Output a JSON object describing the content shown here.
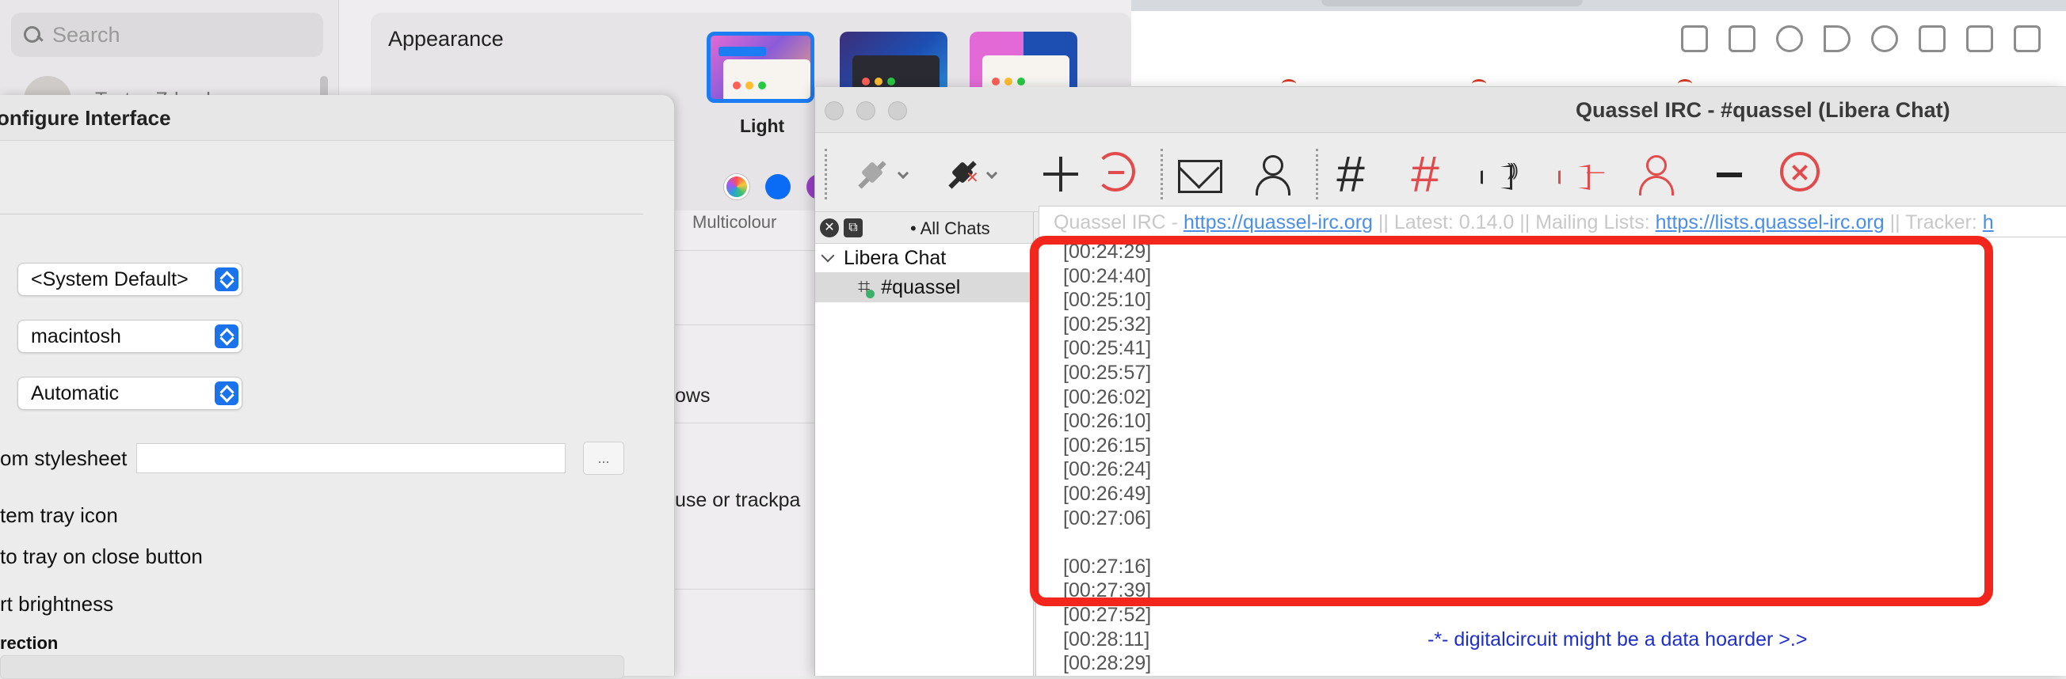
{
  "settings": {
    "search_placeholder": "Search",
    "user_name": "Tsvtsc Zdravkov",
    "appearance_label": "Appearance",
    "theme_light_label": "Light",
    "accent_label": "Multicolour",
    "row_windows": "ows",
    "row_trackpad": "use or trackpa"
  },
  "browser": {
    "toolbar_icons": [
      "edit-icon",
      "camera-icon",
      "shield-icon",
      "send-icon",
      "heart-icon",
      "download-icon",
      "add-icon",
      "sliders-icon"
    ]
  },
  "config": {
    "title": "onfigure Interface",
    "popups": [
      "<System Default>",
      "macintosh",
      "Automatic"
    ],
    "stylesheet_label": "om stylesheet",
    "browse_label": "...",
    "tray_icon_label": "tem tray icon",
    "close_tray_label": "to tray on close button",
    "brightness_label": "rt brightness",
    "direction_label": "rection"
  },
  "quassel": {
    "title": "Quassel IRC - #quassel (Libera Chat)",
    "chatlist_title": "• All Chats",
    "network": "Libera Chat",
    "channel": "#quassel",
    "topic": {
      "prefix": "Quassel IRC - ",
      "link1": "https://quassel-irc.org",
      "mid": " || Latest: 0.14.0 || Mailing Lists: ",
      "link2": "https://lists.quassel-irc.org",
      "suffix": " || Tracker: ",
      "link3": "h"
    },
    "timestamps_top": [
      "[00:24:29]",
      "[00:24:40]",
      "[00:25:10]",
      "[00:25:32]",
      "[00:25:41]",
      "[00:25:57]",
      "[00:26:02]",
      "[00:26:10]",
      "[00:26:15]",
      "[00:26:24]",
      "[00:26:49]",
      "[00:27:06]"
    ],
    "timestamps_bottom": [
      "[00:27:16]",
      "[00:27:39]",
      "[00:27:52]"
    ],
    "message_time": "[00:28:11]",
    "message_text": "-*-  digitalcircuit might be a data hoarder >.>",
    "last_time": "[00:28:29]"
  },
  "colors": {
    "highlight": "#f2261c",
    "accent_blue": "#1a73ed",
    "link": "#4a8ee8",
    "action_text": "#1f2fc9"
  }
}
